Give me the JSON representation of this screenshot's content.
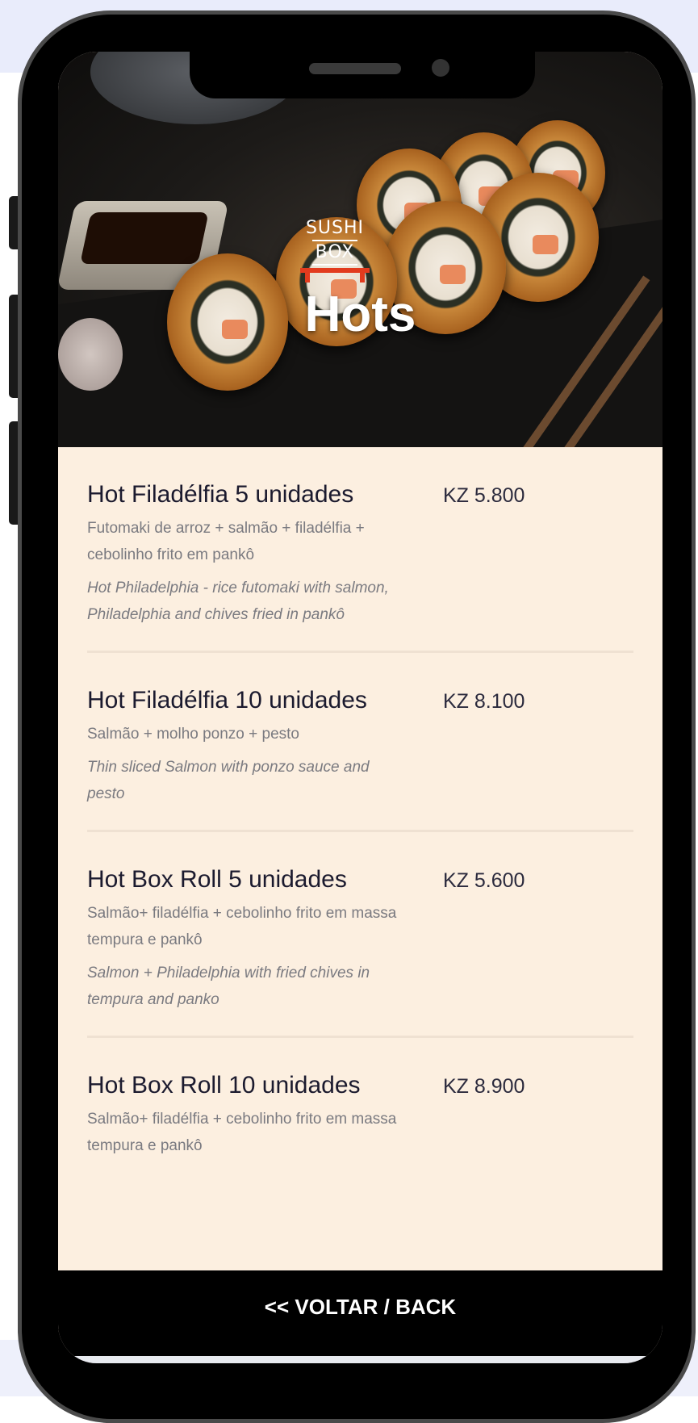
{
  "hero": {
    "logo_top": "SUSHI",
    "logo_bottom": "BOX",
    "title": "Hots"
  },
  "menu": {
    "items": [
      {
        "name": "Hot Filadélfia 5 unidades",
        "price": "KZ 5.800",
        "description_pt": "Futomaki de arroz + salmão + filadélfia + cebolinho frito em pankô",
        "description_en": "Hot Philadelphia - rice futomaki with salmon, Philadelphia and chives fried in pankô"
      },
      {
        "name": "Hot Filadélfia 10 unidades",
        "price": "KZ 8.100",
        "description_pt": "Salmão + molho ponzo + pesto",
        "description_en": "Thin sliced Salmon with ponzo sauce and pesto"
      },
      {
        "name": "Hot Box Roll 5 unidades",
        "price": "KZ 5.600",
        "description_pt": "Salmão+ filadélfia + cebolinho frito em massa tempura e pankô",
        "description_en": "Salmon + Philadelphia with fried chives in tempura and panko"
      },
      {
        "name": "Hot Box Roll 10 unidades",
        "price": "KZ 8.900",
        "description_pt": "Salmão+ filadélfia + cebolinho frito em massa tempura e pankô",
        "description_en": ""
      }
    ]
  },
  "footer": {
    "back_label": "<< VOLTAR / BACK"
  },
  "colors": {
    "background": "#fcefe0",
    "accent": "#e23b1e",
    "bar": "#000000"
  }
}
